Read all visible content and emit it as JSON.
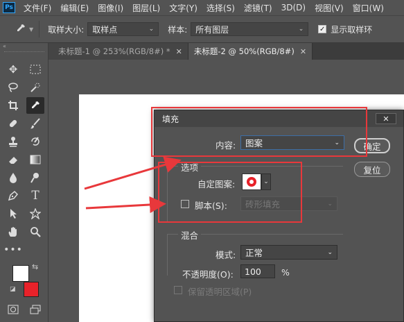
{
  "app": {
    "logo": "Ps"
  },
  "menu": [
    "文件(F)",
    "编辑(E)",
    "图像(I)",
    "图层(L)",
    "文字(Y)",
    "选择(S)",
    "滤镜(T)",
    "3D(D)",
    "视图(V)",
    "窗口(W)"
  ],
  "options": {
    "sample_size_label": "取样大小:",
    "sample_size_value": "取样点",
    "sample_label": "样本:",
    "sample_value": "所有图层",
    "show_ring_label": "显示取样环",
    "show_ring_checked": true
  },
  "tabs": [
    {
      "label": "未标题-1 @ 253%(RGB/8#) *",
      "active": false
    },
    {
      "label": "未标题-2 @ 50%(RGB/8#)",
      "active": true
    }
  ],
  "toolbar": {
    "collapse_icon": "«",
    "tools": [
      "move-icon",
      "marquee-icon",
      "lasso-icon",
      "quick-select-icon",
      "crop-icon",
      "eyedropper-icon",
      "healing-icon",
      "brush-icon",
      "stamp-icon",
      "history-brush-icon",
      "eraser-icon",
      "gradient-icon",
      "blur-icon",
      "dodge-icon",
      "pen-icon",
      "type-icon",
      "path-select-icon",
      "shape-icon",
      "hand-icon",
      "zoom-icon",
      "more-icon"
    ],
    "foreground_color": "#ffffff",
    "background_color": "#e8222a"
  },
  "dialog": {
    "title": "填充",
    "close_label": "✕",
    "content_label": "内容:",
    "content_value": "图案",
    "ok_label": "确定",
    "reset_label": "复位",
    "options_group": "选项",
    "custom_pattern_label": "自定图案:",
    "script_label": "脚本(S):",
    "script_value": "砖形填充",
    "blend_group": "混合",
    "mode_label": "模式:",
    "mode_value": "正常",
    "opacity_label": "不透明度(O):",
    "opacity_value": "100",
    "opacity_unit": "%",
    "preserve_label": "保留透明区域(P)"
  },
  "annotation_color": "#e8383b"
}
